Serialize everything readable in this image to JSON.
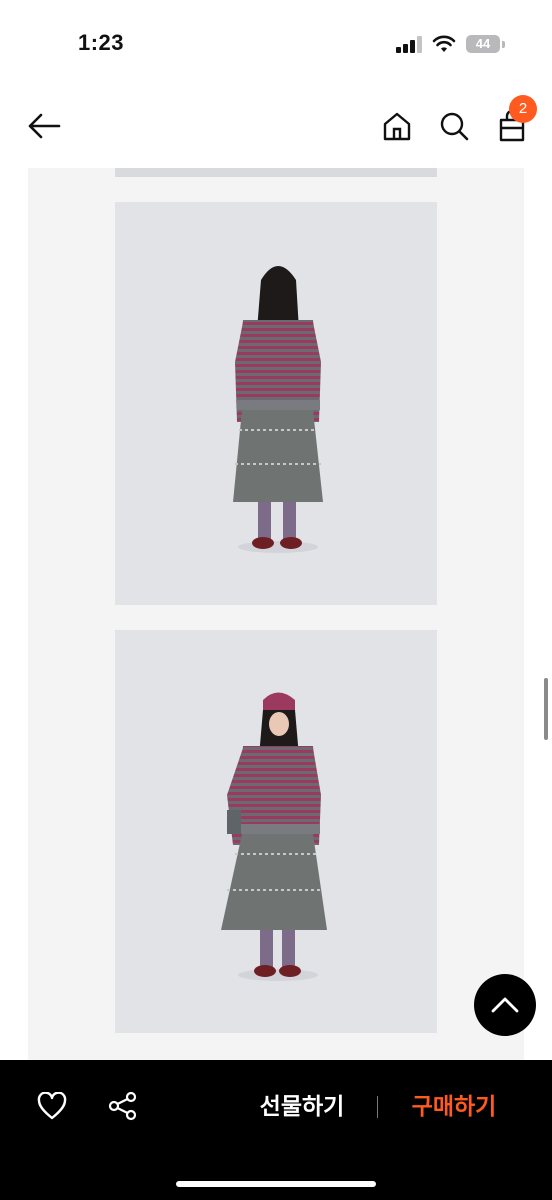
{
  "status_bar": {
    "time": "1:23",
    "battery": "44"
  },
  "nav": {
    "back_icon": "back-arrow-icon",
    "home_icon": "home-icon",
    "search_icon": "search-icon",
    "cart_icon": "shopping-bag-icon",
    "cart_count": "2"
  },
  "photos": [
    {
      "description": "model-back-view"
    },
    {
      "description": "model-front-view"
    }
  ],
  "bottom_bar": {
    "like_icon": "heart-icon",
    "share_icon": "share-icon",
    "gift_label": "선물하기",
    "buy_label": "구매하기"
  },
  "colors": {
    "accent": "#ff5a1f",
    "bottom_bar": "#000000",
    "content_bg": "#f4f4f5"
  }
}
